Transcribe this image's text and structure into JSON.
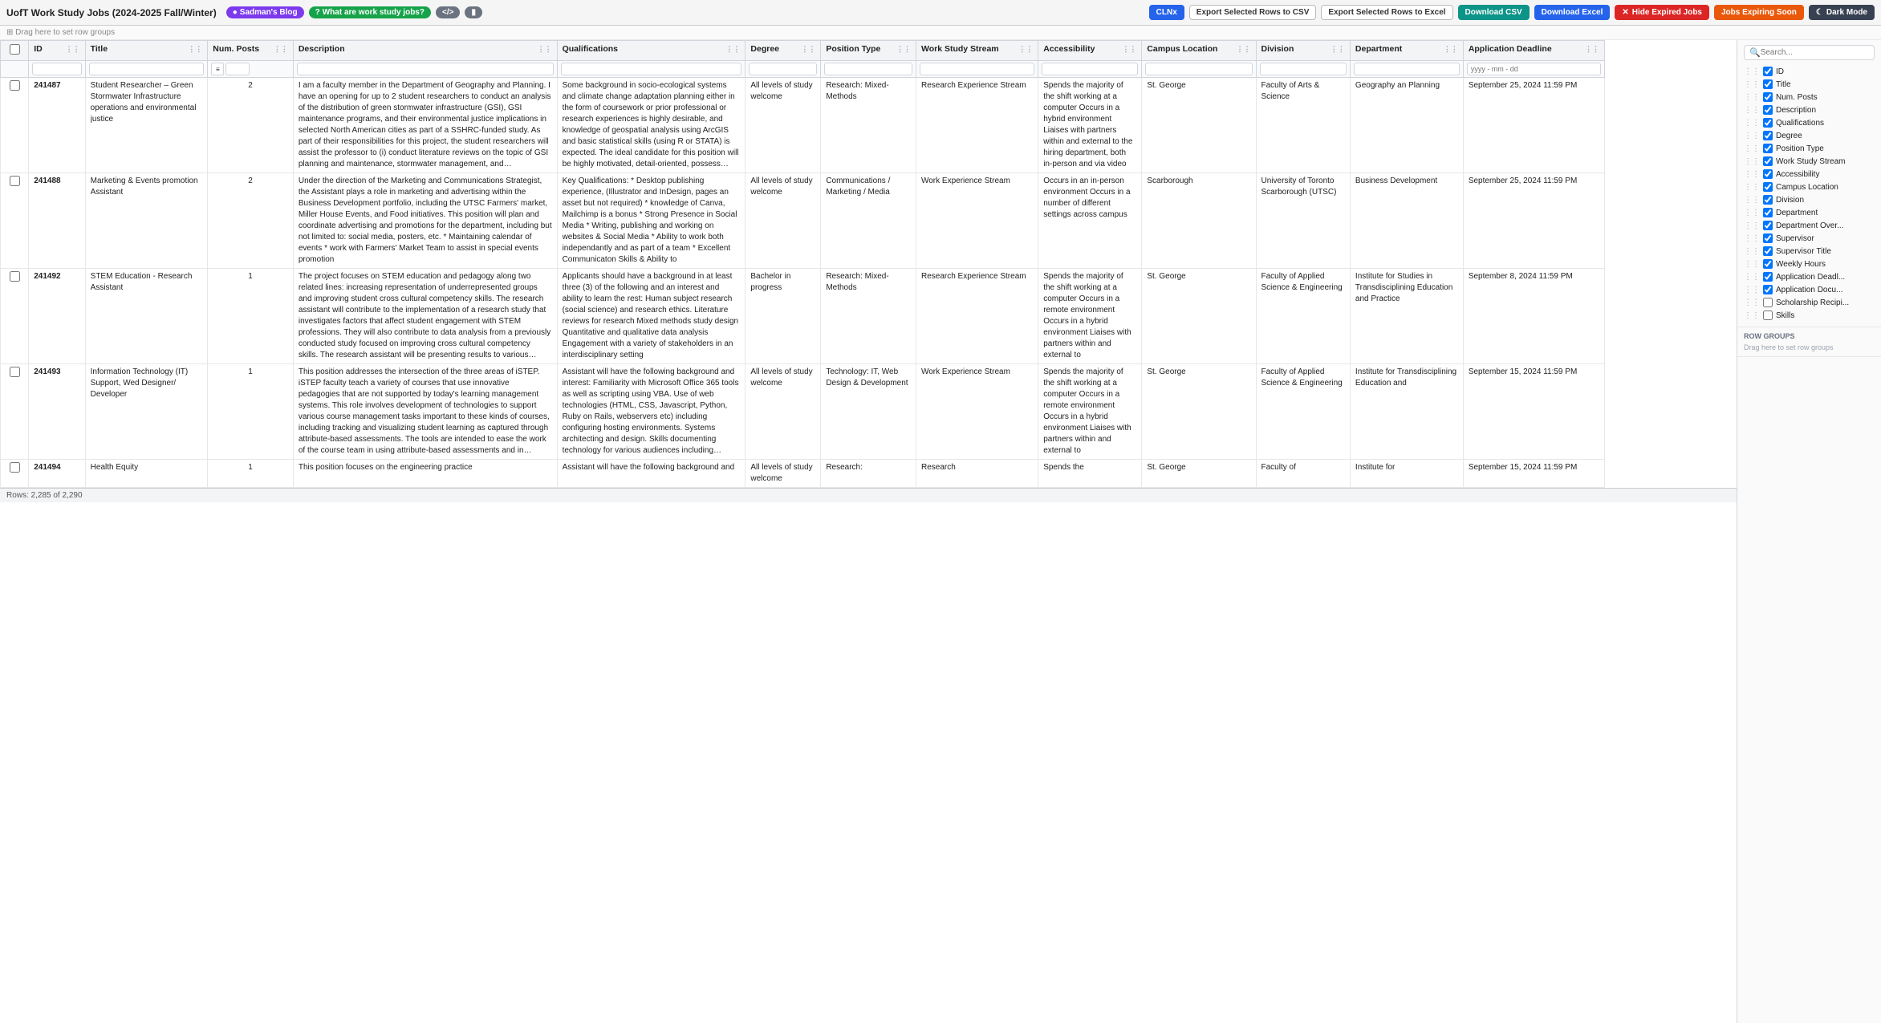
{
  "app": {
    "title": "UofT Work Study Jobs (2024-2025 Fall/Winter)",
    "dragbar": "Drag here to set row groups"
  },
  "topbar": {
    "badges": [
      {
        "label": "Sadman's Blog",
        "style": "purple"
      },
      {
        "label": "What are work study jobs?",
        "style": "green"
      },
      {
        "label": "github-icon",
        "style": "gray"
      },
      {
        "label": "notion-icon",
        "style": "gray"
      }
    ],
    "buttons": [
      {
        "label": "CLNx",
        "style": "blue"
      },
      {
        "label": "Export Selected Rows to CSV",
        "style": "light"
      },
      {
        "label": "Export Selected Rows to Excel",
        "style": "light"
      },
      {
        "label": "Download CSV",
        "style": "teal"
      },
      {
        "label": "Download Excel",
        "style": "blue"
      },
      {
        "label": "Hide Expired Jobs",
        "style": "red"
      },
      {
        "label": "Jobs Expiring Soon",
        "style": "orange"
      },
      {
        "label": "Dark Mode",
        "style": "dark"
      }
    ]
  },
  "columns": [
    {
      "label": "ID",
      "key": "id",
      "checked": true
    },
    {
      "label": "Title",
      "key": "title",
      "checked": true
    },
    {
      "label": "Num. Posts",
      "key": "num_posts",
      "checked": true
    },
    {
      "label": "Description",
      "key": "description",
      "checked": true
    },
    {
      "label": "Qualifications",
      "key": "qualifications",
      "checked": true
    },
    {
      "label": "Degree",
      "key": "degree",
      "checked": true
    },
    {
      "label": "Position Type",
      "key": "position_type",
      "checked": true
    },
    {
      "label": "Work Study Stream",
      "key": "work_study_stream",
      "checked": true
    },
    {
      "label": "Accessibility",
      "key": "accessibility",
      "checked": true
    },
    {
      "label": "Campus Location",
      "key": "campus_location",
      "checked": true
    },
    {
      "label": "Division",
      "key": "division",
      "checked": true
    },
    {
      "label": "Department",
      "key": "department",
      "checked": true
    },
    {
      "label": "Department Over...",
      "key": "department_over",
      "checked": true
    },
    {
      "label": "Supervisor",
      "key": "supervisor",
      "checked": true
    },
    {
      "label": "Supervisor Title",
      "key": "supervisor_title",
      "checked": true
    },
    {
      "label": "Weekly Hours",
      "key": "weekly_hours",
      "checked": true
    },
    {
      "label": "Application Deadl...",
      "key": "application_deadline",
      "checked": true
    },
    {
      "label": "Application Docu...",
      "key": "application_doc",
      "checked": true
    },
    {
      "label": "Scholarship Recipi...",
      "key": "scholarship",
      "checked": false
    },
    {
      "label": "Skills",
      "key": "skills",
      "checked": false
    }
  ],
  "rows": [
    {
      "id": "241487",
      "title": "Student Researcher – Green Stormwater Infrastructure operations and environmental justice",
      "num_posts": "2",
      "description": "I am a faculty member in the Department of Geography and Planning. I have an opening for up to 2 student researchers to conduct an analysis of the distribution of green stormwater infrastructure (GSI), GSI maintenance programs, and their environmental justice implications in selected North American cities as part of a SSHRC-funded study. As part of their responsibilities for this project, the student researchers will assist the professor to (i) conduct literature reviews on the topic of GSI planning and maintenance, stormwater management, and environmental justice flood vulnerability and resilience, (ii) build a database of relevant GSI maintenance programs, policies, plans, and key informants and organizations spearheading these in selected cities, and (iii) contact key",
      "qualifications": "Some background in socio-ecological systems and climate change adaptation planning either in the form of coursework or prior professional or research experiences is highly desirable, and knowledge of geospatial analysis using ArcGIS and basic statistical skills (using R or STATA) is expected. The ideal candidate for this position will be highly motivated, detail-oriented, possess excellent writing and communication skills, and be adept at working with Microsoft Office and G-suite.\n\nStudents from a range of disciplinary backgrounds are encouraged to apply but preference will be given to those with a planning, environmental sustainability, public policy, urban studies, and/ or geography background. Students applying for this",
      "degree": "All levels of study welcome",
      "position_type": "Research: Mixed-Methods",
      "work_study_stream": "Research Experience Stream",
      "accessibility": "Spends the majority of the shift working at a computer\n\nOccurs in a hybrid environment\n\nLiaises with partners within and external to the hiring department, both in-person and via video",
      "campus_location": "St. George",
      "division": "Faculty of Arts & Science",
      "department": "Geography an Planning",
      "deadline": "September 25, 2024 11:59 PM"
    },
    {
      "id": "241488",
      "title": "Marketing & Events promotion Assistant",
      "num_posts": "2",
      "description": "Under the direction of the Marketing and Communications Strategist, the Assistant plays a role in marketing and advertising within the Business Development portfolio, including the UTSC Farmers' market, Miller House Events, and Food initiatives.\n\nThis position will plan and coordinate advertising and promotions for the department, including but not limited to: social media, posters, etc.\n\n* Maintaining calendar of events\n\n* work with Farmers' Market Team to assist in special events promotion",
      "qualifications": "Key Qualifications:\n\n* Desktop publishing experience, (Illustrator and InDesign, pages an asset but not required)\n\n* knowledge of Canva, Mailchimp is a bonus\n\n* Strong Presence in Social Media\n\n* Writing, publishing and working on websites & Social Media\n\n* Ability to work both independantly and as part of a team\n\n* Excellent Communicaton Skills & Ability to",
      "degree": "All levels of study welcome",
      "position_type": "Communications / Marketing / Media",
      "work_study_stream": "Work Experience Stream",
      "accessibility": "Occurs in an in-person environment\n\nOccurs in a number of different settings across campus",
      "campus_location": "Scarborough",
      "division": "University of Toronto Scarborough (UTSC)",
      "department": "Business Development",
      "deadline": "September 25, 2024 11:59 PM"
    },
    {
      "id": "241492",
      "title": "STEM Education - Research Assistant",
      "num_posts": "1",
      "description": "The project focuses on STEM education and pedagogy along two related lines: increasing representation of underrepresented groups and improving student cross cultural competency skills. The research assistant will contribute to the implementation of a research study that investigates factors that affect student engagement with STEM professions. They will also contribute to data analysis from a previously conducted study focused on improving cross cultural competency skills. The research assistant will be presenting results to various audiences (academic and non-academic, internal and external).\n\nAssistant must be able to or willing to learn how to do the following:",
      "qualifications": "Applicants should have a background in at least three (3) of the following and an interest and ability to learn the rest:\n\nHuman subject research (social science) and research ethics.\n\nLiterature reviews for research\n\nMixed methods study design\n\nQuantitative and qualitative data analysis\n\nEngagement with a variety of stakeholders in an interdisciplinary setting",
      "degree": "Bachelor in progress",
      "position_type": "Research: Mixed-Methods",
      "work_study_stream": "Research Experience Stream",
      "accessibility": "Spends the majority of the shift working at a computer\n\nOccurs in a remote environment\n\nOccurs in a hybrid environment\n\nLiaises with partners within and external to",
      "campus_location": "St. George",
      "division": "Faculty of Applied Science & Engineering",
      "department": "Institute for Studies in Transdisciplining Education and Practice",
      "deadline": "September 8, 2024 11:59 PM"
    },
    {
      "id": "241493",
      "title": "Information Technology (IT) Support, Wed Designer/ Developer",
      "num_posts": "1",
      "description": "This position addresses the intersection of the three areas of iSTEP. iSTEP faculty teach a variety of courses that use innovative pedagogies that are not supported by today's learning management systems. This role involves development of technologies to support various course management tasks important to these kinds of courses, including tracking and visualizing student learning as captured through attribute-based assessments. The tools are intended to ease the work of the course team in using attribute-based assessments and in tracking student learning. The resulting applications will be self-hosted web-based technologies. The developer will work with supervisor closely on considerations for various technologies and possibly with IT staff in the Faculty",
      "qualifications": "Assistant will have the following background and interest:\n\nFamiliarity with Microsoft Office 365 tools as well as scripting using VBA.\n\nUse of web technologies (HTML, CSS, Javascript, Python, Ruby on Rails, webservers etc) including configuring hosting environments.\n\nSystems architecting and design.\n\nSkills documenting technology for various audiences including administrators and users.\n\nAll required work can be done remotely.",
      "degree": "All levels of study welcome",
      "position_type": "Technology: IT, Web Design & Development",
      "work_study_stream": "Work Experience Stream",
      "accessibility": "Spends the majority of the shift working at a computer\n\nOccurs in a remote environment\n\nOccurs in a hybrid environment\n\nLiaises with partners within and external to",
      "campus_location": "St. George",
      "division": "Faculty of Applied Science & Engineering",
      "department": "Institute for Transdisciplining Education and",
      "deadline": "September 15, 2024 11:59 PM"
    },
    {
      "id": "241494",
      "title": "Health Equity",
      "num_posts": "1",
      "description": "This position focuses on the engineering practice",
      "qualifications": "Assistant will have the following background and",
      "degree": "All levels of study welcome",
      "position_type": "Research:",
      "work_study_stream": "Research",
      "accessibility": "Spends the",
      "campus_location": "St. George",
      "division": "Faculty of",
      "department": "Institute for",
      "deadline": "September 15, 2024 11:59 PM"
    }
  ],
  "footer": {
    "rows_text": "Rows: 2,285 of 2,290"
  },
  "right_panel": {
    "search_placeholder": "Search...",
    "row_groups_label": "Row Groups",
    "drag_label": "Drag here to set row groups"
  }
}
